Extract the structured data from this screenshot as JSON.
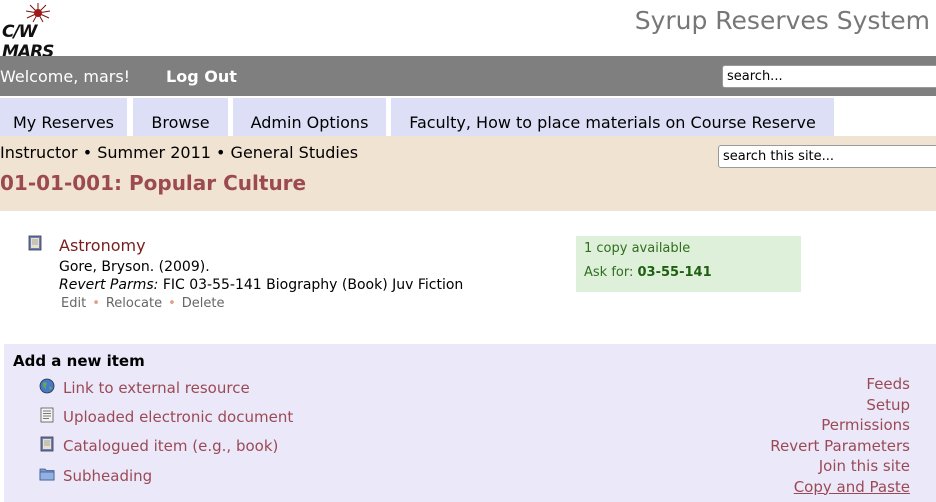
{
  "header": {
    "logo_text": "C/W MARS",
    "app_title": "Syrup Reserves System"
  },
  "navbar": {
    "welcome": "Welcome, mars!",
    "logout": "Log Out",
    "search_value": "search..."
  },
  "tabs": [
    {
      "label": "My Reserves"
    },
    {
      "label": "Browse"
    },
    {
      "label": "Admin Options"
    },
    {
      "label": "Faculty, How to place materials on Course Reserve"
    }
  ],
  "course": {
    "breadcrumb": "Instructor • Summer 2011 • General Studies",
    "title": "01-01-001: Popular Culture",
    "search_value": "search this site..."
  },
  "item": {
    "title": "Astronomy",
    "author": "Gore, Bryson. (2009).",
    "call_label": "Revert Parms:",
    "call_value": " FIC 03-55-141 Biography (Book) Juv Fiction",
    "actions": {
      "edit": "Edit",
      "relocate": "Relocate",
      "delete": "Delete",
      "separator": "•"
    },
    "availability": {
      "copies": "1 copy available",
      "ask_label": "Ask for: ",
      "ask_value": "03-55-141"
    }
  },
  "add_panel": {
    "title": "Add a new item",
    "options": [
      {
        "label": "Link to external resource",
        "icon": "globe-icon"
      },
      {
        "label": "Uploaded electronic document",
        "icon": "document-icon"
      },
      {
        "label": "Catalogued item (e.g., book)",
        "icon": "book-icon"
      },
      {
        "label": "Subheading",
        "icon": "folder-icon"
      }
    ]
  },
  "side_links": [
    {
      "label": "Feeds"
    },
    {
      "label": "Setup"
    },
    {
      "label": "Permissions"
    },
    {
      "label": "Revert Parameters"
    },
    {
      "label": "Join this site"
    },
    {
      "label": "Copy and Paste"
    }
  ]
}
